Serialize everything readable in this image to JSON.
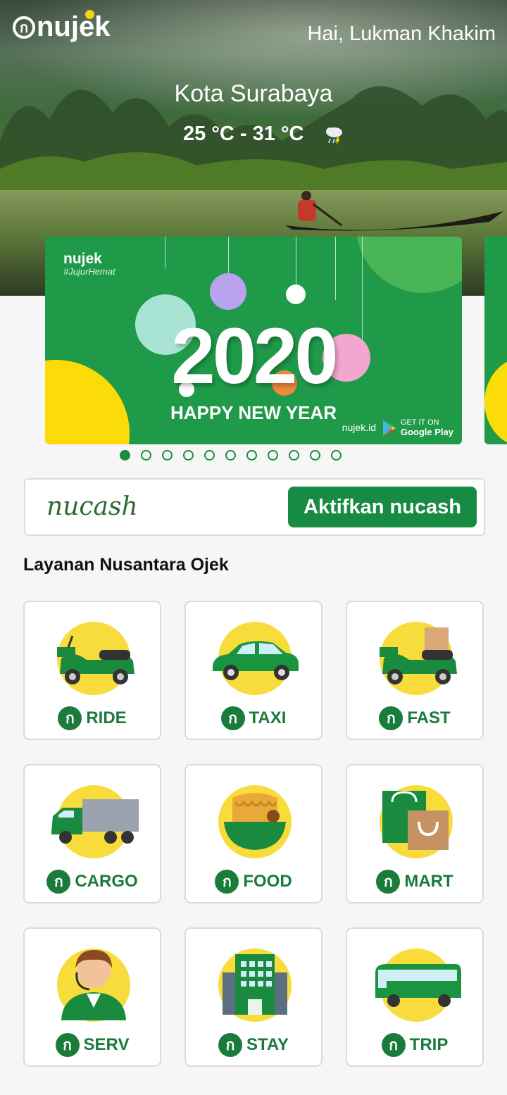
{
  "header": {
    "brand": "nujek",
    "greeting": "Hai, Lukman Khakim",
    "city": "Kota Surabaya",
    "temperature": "25 °C - 31 °C",
    "weather_icon": "rain-cloud-icon"
  },
  "banner": {
    "brand": "nujek",
    "tagline": "#JujurHemat",
    "year": "2020",
    "headline": "HAPPY NEW YEAR",
    "site": "nujek.id",
    "store_small": "GET IT ON",
    "store_name": "Google Play",
    "pages": 11,
    "active_page": 1
  },
  "nucash": {
    "logo": "nucash",
    "button": "Aktifkan nucash"
  },
  "services": {
    "title": "Layanan Nusantara Ojek",
    "items": [
      {
        "label": "RIDE",
        "icon": "scooter-icon"
      },
      {
        "label": "TAXI",
        "icon": "car-icon"
      },
      {
        "label": "FAST",
        "icon": "scooter-delivery-icon"
      },
      {
        "label": "CARGO",
        "icon": "truck-icon"
      },
      {
        "label": "FOOD",
        "icon": "noodle-bowl-icon"
      },
      {
        "label": "MART",
        "icon": "shopping-bag-icon"
      },
      {
        "label": "SERV",
        "icon": "customer-service-icon"
      },
      {
        "label": "STAY",
        "icon": "hotel-building-icon"
      },
      {
        "label": "TRIP",
        "icon": "bus-icon"
      }
    ]
  },
  "colors": {
    "primary_green": "#178a43",
    "accent_yellow": "#fbdc08"
  }
}
